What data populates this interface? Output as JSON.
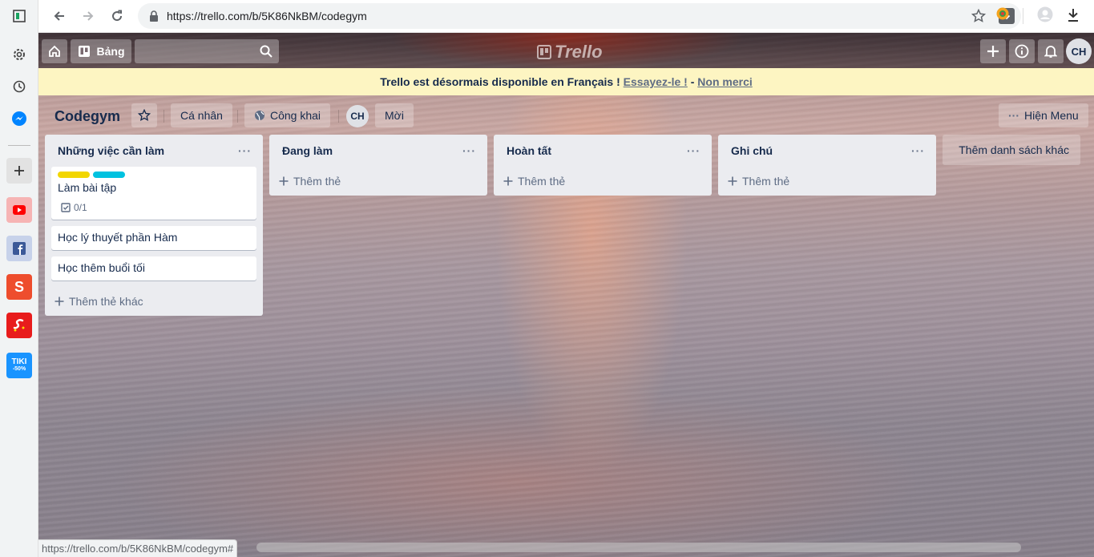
{
  "browser": {
    "url": "https://trello.com/b/5K86NkBM/codegym",
    "status_url": "https://trello.com/b/5K86NkBM/codegym#"
  },
  "sidebar": {
    "items": [
      {
        "name": "settings-icon"
      },
      {
        "name": "history-icon"
      },
      {
        "name": "messenger-icon"
      },
      {
        "name": "add-icon"
      },
      {
        "name": "youtube-icon"
      },
      {
        "name": "facebook-icon"
      },
      {
        "name": "shopee-icon",
        "text": "S"
      },
      {
        "name": "sendo-icon"
      },
      {
        "name": "tiki-icon",
        "text": "TIKI",
        "subtext": "-50%"
      }
    ]
  },
  "header": {
    "boards_label": "Bảng",
    "logo_text": "Trello",
    "avatar": "CH"
  },
  "banner": {
    "text": "Trello est désormais disponible en Français !",
    "try_link": "Essayez-le !",
    "separator": "-",
    "decline_link": "Non merci"
  },
  "board": {
    "title": "Codegym",
    "team": "Cá nhân",
    "visibility": "Công khai",
    "member": "CH",
    "invite": "Mời",
    "menu": "Hiện Menu"
  },
  "lists": [
    {
      "title": "Những việc cần làm",
      "cards": [
        {
          "title": "Làm bài tập",
          "labels": [
            "#f2d600",
            "#00c2e0"
          ],
          "checklist": "0/1"
        },
        {
          "title": "Học lý thuyết phần Hàm"
        },
        {
          "title": "Học thêm buổi tối"
        }
      ],
      "add": "Thêm thẻ khác"
    },
    {
      "title": "Đang làm",
      "cards": [],
      "add": "Thêm thẻ"
    },
    {
      "title": "Hoàn tất",
      "cards": [],
      "add": "Thêm thẻ"
    },
    {
      "title": "Ghi chú",
      "cards": [],
      "add": "Thêm thẻ"
    }
  ],
  "add_list": "Thêm danh sách khác",
  "list_menu": "···"
}
